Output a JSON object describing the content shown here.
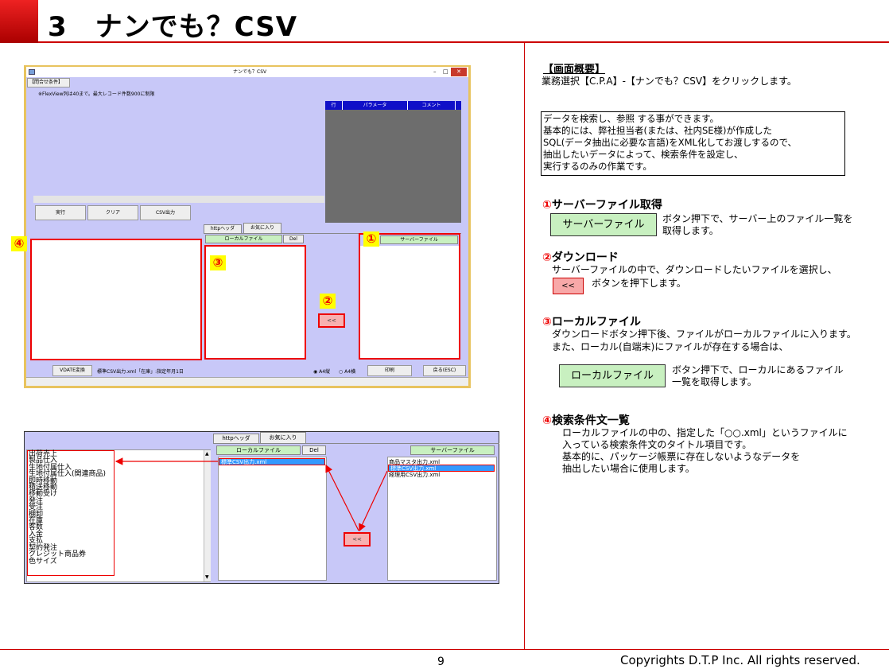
{
  "header": {
    "title": "3　ナンでも？CSV"
  },
  "footer": {
    "page_number": "9",
    "copyright": "Copyrights  D.T.P Inc. All rights reserved."
  },
  "window1": {
    "title": "ナンでも？CSV",
    "tab": "【問合せ条件】",
    "note": "※FlexView列は40まで。最大レコード件数900に制限",
    "grid_headers": [
      "行",
      "パラメータ",
      "コメント"
    ],
    "buttons": {
      "execute": "実行",
      "clear": "クリア",
      "csv_output": "CSV出力"
    },
    "tabs": {
      "http_header": "httpヘッダ",
      "favorites": "お気に入り"
    },
    "local_file_button": "ローカルファイル",
    "del_button": "Del",
    "server_file_button": "サーバーファイル",
    "download_button": "<<",
    "status": {
      "vdate_button": "VDATE変換",
      "status_text": "標準CSV出力.xml「在庫」:指定年月1日",
      "radio_a4_portrait": "A4縦",
      "radio_a4_landscape": "A4横",
      "print_button": "印刷",
      "back_button": "戻る(ESC)"
    },
    "badges": {
      "b1": "①",
      "b2": "②",
      "b3": "③",
      "b4": "④"
    }
  },
  "window2": {
    "tabs": {
      "http_header": "httpヘッダ",
      "favorites": "お気に入り"
    },
    "local_file_button": "ローカルファイル",
    "del_button": "Del",
    "server_file_button": "サーバーファイル",
    "download_button": "<<",
    "condition_list": [
      "出荷売上",
      "製品仕入",
      "生地付属仕入",
      "生地付属仕入(関連商品)",
      "即時移動",
      "積送移動",
      "移動受け",
      "発注",
      "受注",
      "棚卸",
      "在庫",
      "客数",
      "入金",
      "支払",
      "契約発注",
      "クレジット商品券",
      "色サイズ"
    ],
    "local_files": [
      "標準CSV出力.xml"
    ],
    "server_files": [
      "商品マスタ出力.xml",
      "標準CSV出力.xml",
      "経理用CSV出力.xml"
    ]
  },
  "right": {
    "overview_title": "【画面概要】",
    "overview_text": "業務選択【C.P.A】-【ナンでも？CSV】をクリックします。",
    "info_lines": [
      "データを検索し、参照 する事ができます。",
      "基本的には、弊社担当者(または、社内SE様)が作成した",
      "SQL(データ抽出に必要な言語)をXML化してお渡しするので、",
      "抽出したいデータによって、検索条件を設定し、",
      "実行するのみの作業です。"
    ],
    "s1": {
      "num": "①",
      "title": "サーバーファイル取得",
      "button": "サーバーファイル",
      "desc1": "ボタン押下で、サーバー上のファイル一覧を",
      "desc2": "取得します。"
    },
    "s2": {
      "num": "②",
      "title": "ダウンロード",
      "desc1": "サーバーファイルの中で、ダウンロードしたいファイルを選択し、",
      "button": "<<",
      "desc2": "ボタンを押下します。"
    },
    "s3": {
      "num": "③",
      "title": "ローカルファイル",
      "desc1": "ダウンロードボタン押下後、ファイルがローカルファイルに入ります。",
      "desc2": "また、ローカル(自端末)にファイルが存在する場合は、",
      "button": "ローカルファイル",
      "desc3": "ボタン押下で、ローカルにあるファイル",
      "desc4": "一覧を取得します。"
    },
    "s4": {
      "num": "④",
      "title": "検索条件文一覧",
      "lines": [
        "ローカルファイルの中の、指定した「○○.xml」というファイルに",
        "入っている検索条件文のタイトル項目です。",
        "基本的に、パッケージ帳票に存在しないようなデータを",
        "抽出したい場合に使用します。"
      ]
    },
    "colors": {
      "accent": "#cc0000",
      "green_button": "#c8f0c0",
      "pink_button": "#f8a8a8"
    }
  }
}
